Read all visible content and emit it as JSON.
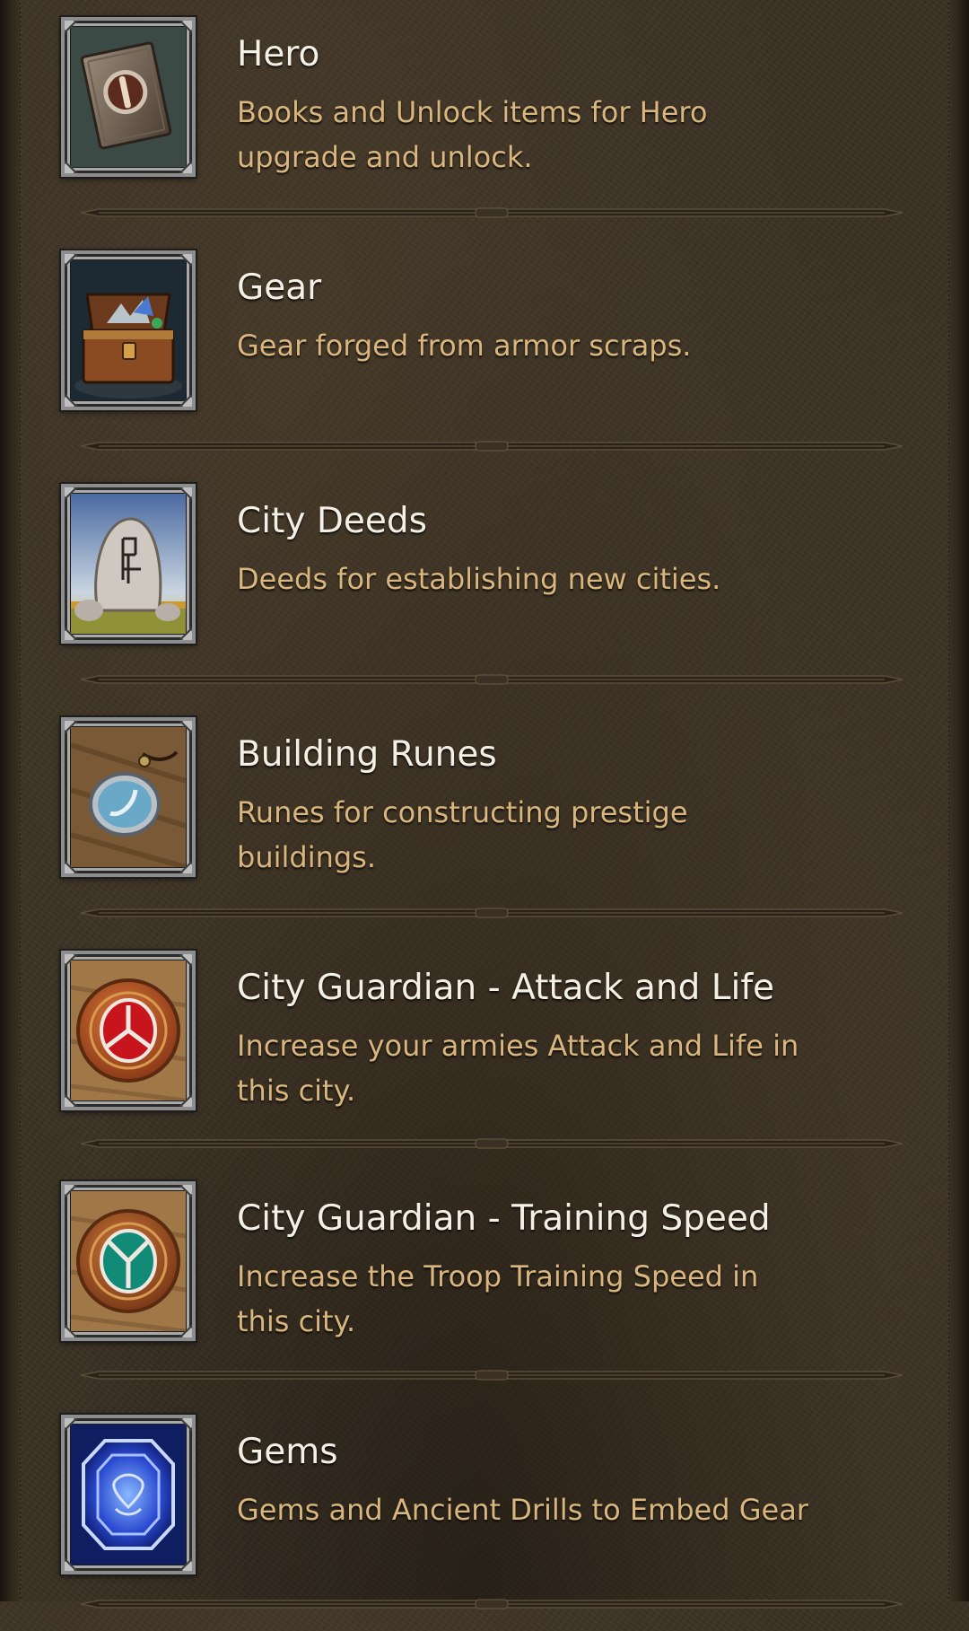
{
  "items": [
    {
      "title": "Hero",
      "description": "Books and Unlock items for Hero upgrade and unlock.",
      "icon": "hero-book-icon"
    },
    {
      "title": "Gear",
      "description": "Gear forged from armor scraps.",
      "icon": "treasure-chest-icon"
    },
    {
      "title": "City Deeds",
      "description": "Deeds for establishing new cities.",
      "icon": "runestone-icon"
    },
    {
      "title": "Building Runes",
      "description": "Runes for constructing prestige buildings.",
      "icon": "rune-pendant-icon"
    },
    {
      "title": "City Guardian - Attack and Life",
      "description": "Increase your armies Attack and Life in this city.",
      "icon": "red-guardian-shield-icon"
    },
    {
      "title": "City Guardian - Training Speed",
      "description": "Increase the Troop Training Speed in this city.",
      "icon": "green-guardian-shield-icon"
    },
    {
      "title": "Gems",
      "description": "Gems and Ancient Drills to Embed Gear",
      "icon": "blue-gem-icon"
    }
  ],
  "colors": {
    "background": "#3a3124",
    "title_text": "#f4f0e6",
    "description_text": "#d8b67e"
  }
}
